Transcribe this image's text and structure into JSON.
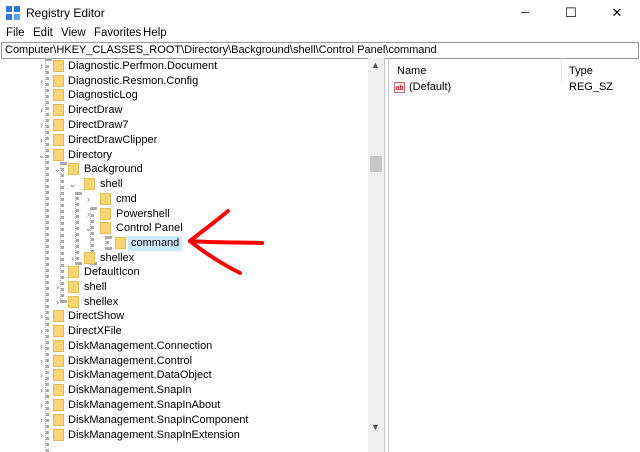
{
  "window": {
    "title": "Registry Editor",
    "minimize_glyph": "─",
    "maximize_glyph": "☐",
    "close_glyph": "✕"
  },
  "menu": [
    "File",
    "Edit",
    "View",
    "Favorites",
    "Help"
  ],
  "address": "Computer\\HKEY_CLASSES_ROOT\\Directory\\Background\\shell\\Control Panel\\command",
  "tree": [
    {
      "label": "Diagnostic.Perfmon.Document",
      "expander": "›"
    },
    {
      "label": "Diagnostic.Resmon.Config",
      "expander": "›"
    },
    {
      "label": "DiagnosticLog",
      "expander": ""
    },
    {
      "label": "DirectDraw",
      "expander": "›"
    },
    {
      "label": "DirectDraw7",
      "expander": "›"
    },
    {
      "label": "DirectDrawClipper",
      "expander": "›"
    },
    {
      "label": "Directory",
      "expander": "⌄"
    },
    {
      "label": "Background",
      "expander": "⌄"
    },
    {
      "label": "shell",
      "expander": "⌄"
    },
    {
      "label": "cmd",
      "expander": "›"
    },
    {
      "label": "Powershell",
      "expander": "›"
    },
    {
      "label": "Control Panel",
      "expander": "⌄"
    },
    {
      "label": "command",
      "expander": ""
    },
    {
      "label": "shellex",
      "expander": "›"
    },
    {
      "label": "DefaultIcon",
      "expander": ""
    },
    {
      "label": "shell",
      "expander": "›"
    },
    {
      "label": "shellex",
      "expander": "›"
    },
    {
      "label": "DirectShow",
      "expander": "›"
    },
    {
      "label": "DirectXFile",
      "expander": "›"
    },
    {
      "label": "DiskManagement.Connection",
      "expander": "›"
    },
    {
      "label": "DiskManagement.Control",
      "expander": "›"
    },
    {
      "label": "DiskManagement.DataObject",
      "expander": "›"
    },
    {
      "label": "DiskManagement.SnapIn",
      "expander": "›"
    },
    {
      "label": "DiskManagement.SnapInAbout",
      "expander": "›"
    },
    {
      "label": "DiskManagement.SnapInComponent",
      "expander": "›"
    },
    {
      "label": "DiskManagement.SnapInExtension",
      "expander": "›"
    }
  ],
  "values_pane": {
    "columns": [
      "Name",
      "Type"
    ],
    "rows": [
      {
        "name": "(Default)",
        "type": "REG_SZ",
        "icon": "ab"
      }
    ]
  },
  "scrollbar": {
    "up_glyph": "▲",
    "down_glyph": "▼"
  },
  "colors": {
    "annotation_arrow": "#ff0000",
    "selection": "#cce8ff"
  }
}
